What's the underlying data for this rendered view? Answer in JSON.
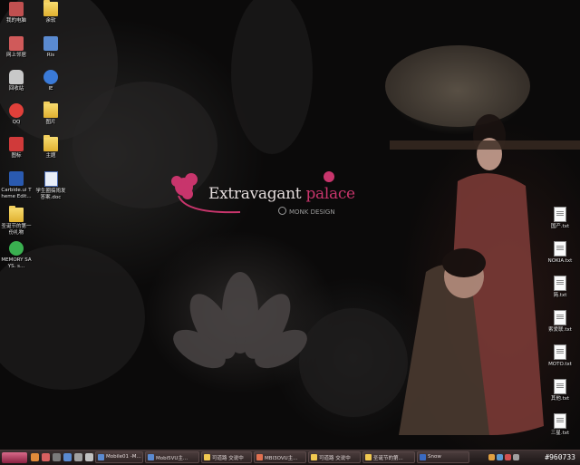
{
  "desktop": {
    "icons": [
      {
        "label": "我的电脑",
        "icon": "my-computer-icon"
      },
      {
        "label": "余软",
        "icon": "folder-icon"
      },
      {
        "label": "网上邻居",
        "icon": "network-icon"
      },
      {
        "label": "Ris",
        "icon": "app-icon"
      },
      {
        "label": "回收站",
        "icon": "recycle-bin-icon"
      },
      {
        "label": "IE",
        "icon": "ie-icon"
      },
      {
        "label": "QQ",
        "icon": "qq-icon"
      },
      {
        "label": "图片",
        "icon": "folder-icon"
      },
      {
        "label": "图标",
        "icon": "app-icon"
      },
      {
        "label": "主题",
        "icon": "folder-icon"
      },
      {
        "label": "Carbide.ui Theme Edit...",
        "icon": "ui-icon"
      },
      {
        "label": "学生圈搞闹发答案.doc",
        "icon": "doc-icon"
      },
      {
        "label": "圣诞节的第一份礼物",
        "icon": "folder-icon"
      },
      {
        "label": "MEMORY SAYS. s...",
        "icon": "memory-icon"
      }
    ],
    "right_icons": [
      {
        "label": "国产.txt",
        "icon": "txt-file-icon"
      },
      {
        "label": "NOKIA.txt",
        "icon": "txt-file-icon"
      },
      {
        "label": "简.txt",
        "icon": "txt-file-icon"
      },
      {
        "label": "索爱联.txt",
        "icon": "txt-file-icon"
      },
      {
        "label": "MOTO.txt",
        "icon": "txt-file-icon"
      },
      {
        "label": "其他.txt",
        "icon": "txt-file-icon"
      },
      {
        "label": "三星.txt",
        "icon": "txt-file-icon"
      }
    ]
  },
  "wallpaper": {
    "title_a": "Extravagant ",
    "title_b": "palace",
    "subtitle": "MONK DESIGN"
  },
  "taskbar": {
    "tasks": [
      {
        "label": "Mobile01 -M..."
      },
      {
        "label": "Mobi5VU主..."
      },
      {
        "label": "可道路 交说中"
      },
      {
        "label": "MBI3OVU主..."
      },
      {
        "label": "可道路 交说中"
      },
      {
        "label": "圣诞节的第..."
      },
      {
        "label": "Snow"
      }
    ],
    "clock": "#960733"
  },
  "colors": {
    "accent": "#c8356c",
    "taskbar": "#2a2020"
  }
}
